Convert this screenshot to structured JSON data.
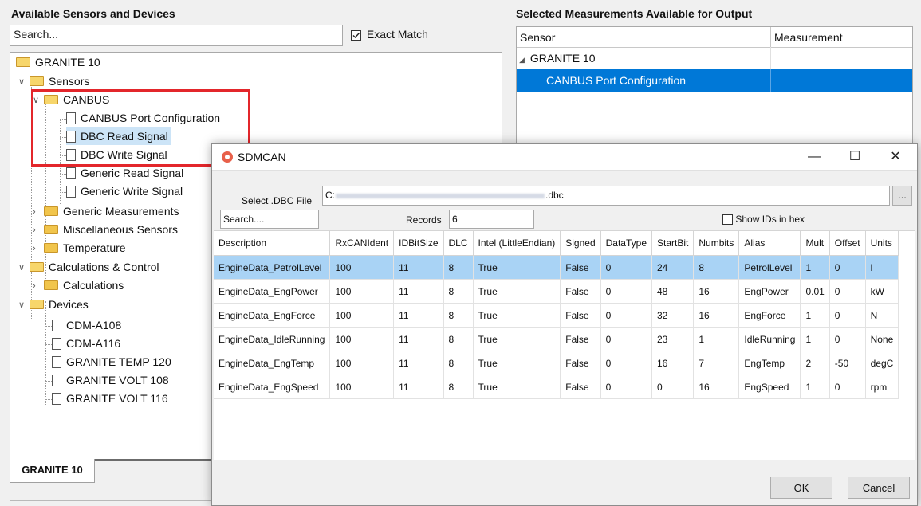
{
  "left_panel": {
    "title": "Available Sensors and Devices",
    "search_placeholder": "Search...",
    "exact_match_label": "Exact Match",
    "exact_match_checked": true,
    "tree": {
      "root": "GRANITE 10",
      "sensors": "Sensors",
      "canbus": "CANBUS",
      "canbus_port": "CANBUS Port Configuration",
      "dbc_read": "DBC Read Signal",
      "dbc_write": "DBC Write Signal",
      "generic_read": "Generic Read Signal",
      "generic_write": "Generic Write Signal",
      "generic_meas": "Generic Measurements",
      "misc_sensors": "Miscellaneous Sensors",
      "temperature": "Temperature",
      "calc_control": "Calculations & Control",
      "calculations": "Calculations",
      "devices": "Devices",
      "cdm_a108": "CDM-A108",
      "cdm_a116": "CDM-A116",
      "granite_temp": "GRANITE TEMP 120",
      "granite_volt108": "GRANITE VOLT 108",
      "granite_volt116": "GRANITE VOLT 116"
    },
    "tab_label": "GRANITE 10"
  },
  "right_panel": {
    "title": "Selected Measurements Available for Output",
    "col_sensor": "Sensor",
    "col_measurement": "Measurement",
    "root": "GRANITE 10",
    "selected_item": "CANBUS Port Configuration"
  },
  "dialog": {
    "title": "SDMCAN",
    "select_dbc_label": "Select .DBC File",
    "dbc_path_prefix": "C:",
    "dbc_path_suffix": ".dbc",
    "browse_label": "...",
    "search_placeholder": "Search....",
    "records_label": "Records",
    "records_value": "6",
    "show_hex_label": "Show IDs in hex",
    "columns": [
      "Description",
      "RxCANIdent",
      "IDBitSize",
      "DLC",
      "Intel (LittleEndian)",
      "Signed",
      "DataType",
      "StartBit",
      "Numbits",
      "Alias",
      "Mult",
      "Offset",
      "Units"
    ],
    "rows": [
      [
        "EngineData_PetrolLevel",
        "100",
        "11",
        "8",
        "True",
        "False",
        "0",
        "24",
        "8",
        "PetrolLevel",
        "1",
        "0",
        "l"
      ],
      [
        "EngineData_EngPower",
        "100",
        "11",
        "8",
        "True",
        "False",
        "0",
        "48",
        "16",
        "EngPower",
        "0.01",
        "0",
        "kW"
      ],
      [
        "EngineData_EngForce",
        "100",
        "11",
        "8",
        "True",
        "False",
        "0",
        "32",
        "16",
        "EngForce",
        "1",
        "0",
        "N"
      ],
      [
        "EngineData_IdleRunning",
        "100",
        "11",
        "8",
        "True",
        "False",
        "0",
        "23",
        "1",
        "IdleRunning",
        "1",
        "0",
        "None"
      ],
      [
        "EngineData_EngTemp",
        "100",
        "11",
        "8",
        "True",
        "False",
        "0",
        "16",
        "7",
        "EngTemp",
        "2",
        "-50",
        "degC"
      ],
      [
        "EngineData_EngSpeed",
        "100",
        "11",
        "8",
        "True",
        "False",
        "0",
        "0",
        "16",
        "EngSpeed",
        "1",
        "0",
        "rpm"
      ]
    ],
    "ok_label": "OK",
    "cancel_label": "Cancel",
    "minimize_glyph": "—",
    "maximize_glyph": "☐",
    "close_glyph": "✕"
  },
  "colors": {
    "selection_blue": "#0078d7",
    "row_highlight": "#a9d3f5",
    "annotation_red": "#e3262b"
  }
}
